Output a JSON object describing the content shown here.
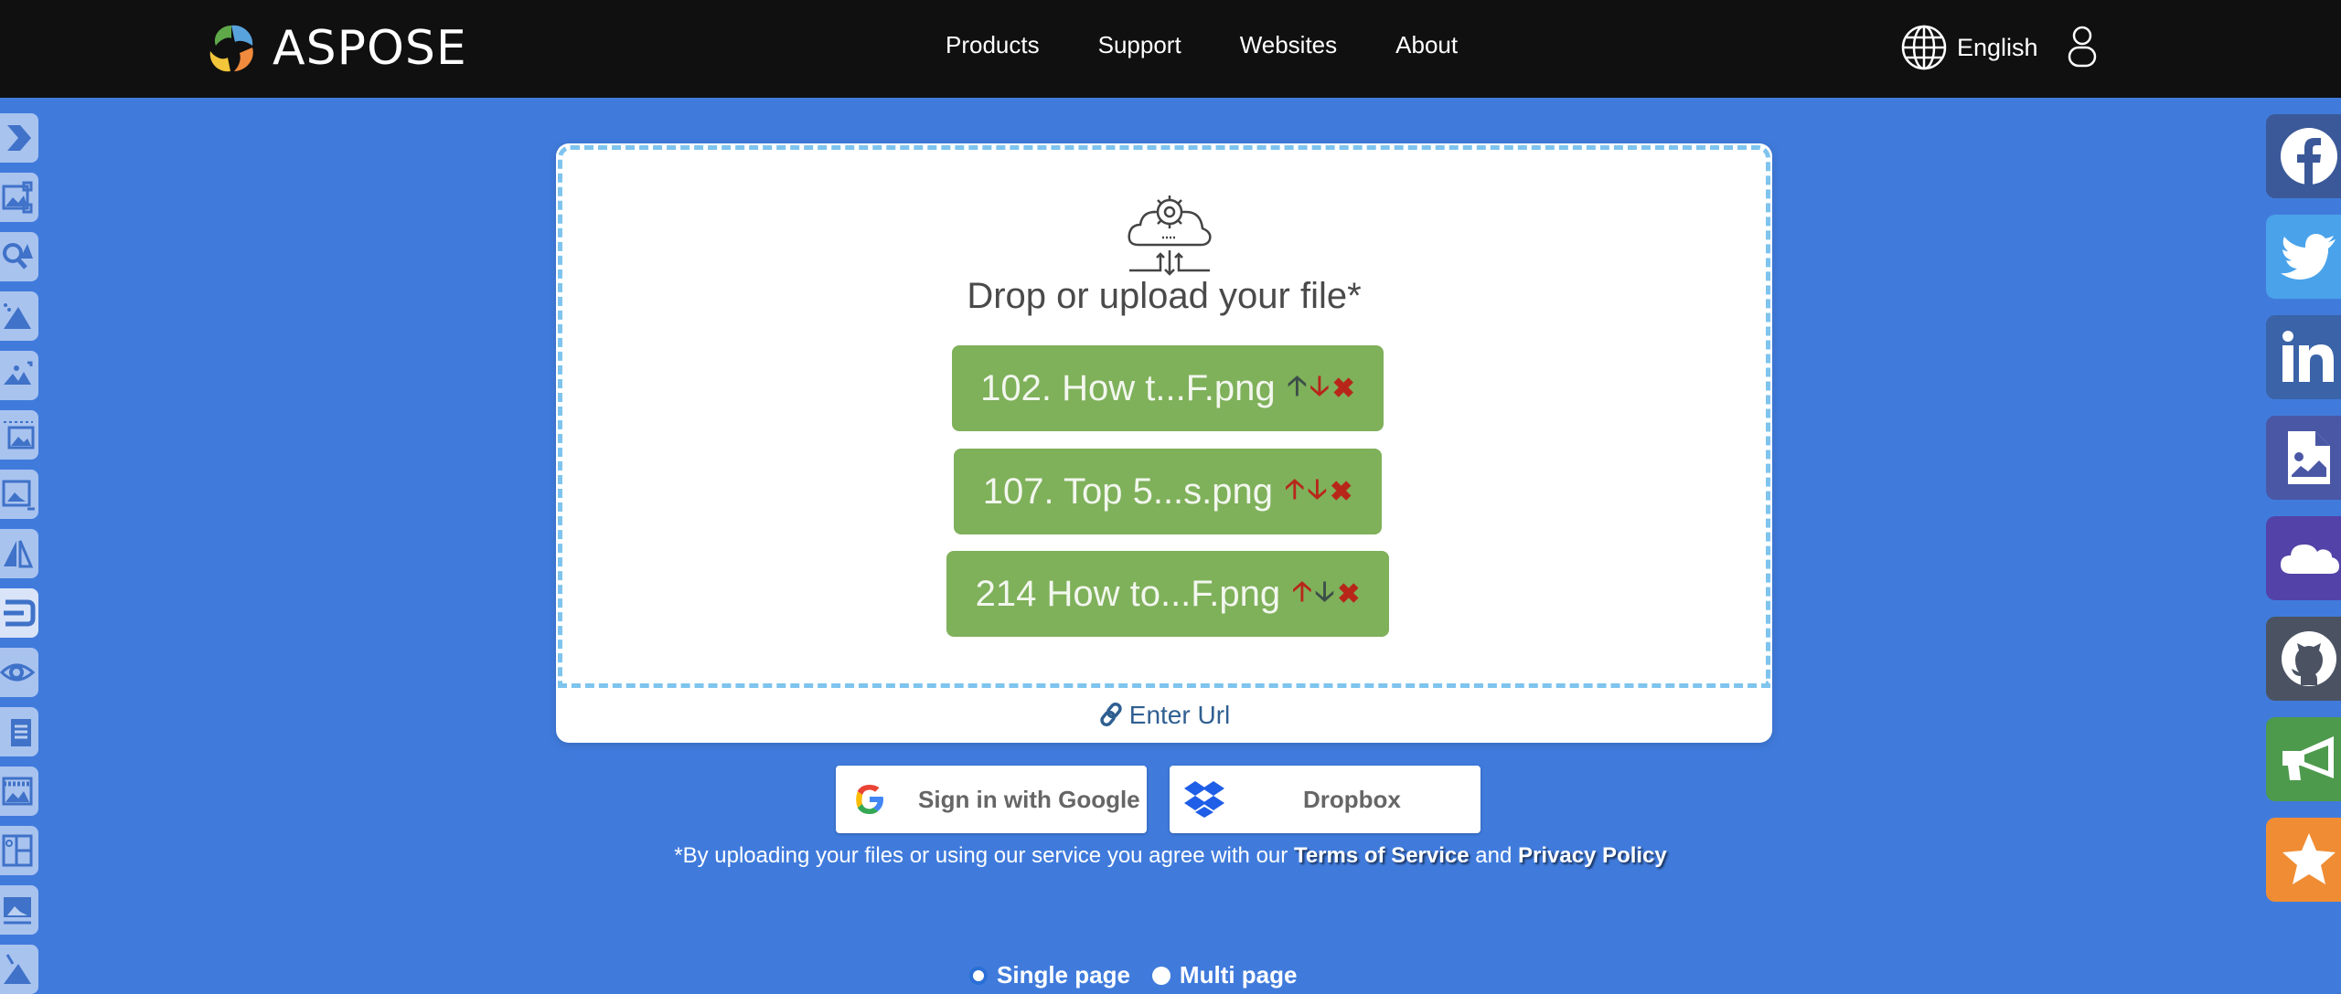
{
  "header": {
    "brand": "ASPOSE",
    "nav": [
      "Products",
      "Support",
      "Websites",
      "About"
    ],
    "language": "English"
  },
  "left_rail": {
    "items": [
      {
        "icon": "chevron-right-icon"
      },
      {
        "icon": "image-resize-icon"
      },
      {
        "icon": "image-search-icon"
      },
      {
        "icon": "image-compress-icon"
      },
      {
        "icon": "image-crop-icon"
      },
      {
        "icon": "image-border-icon"
      },
      {
        "icon": "image-frame-icon"
      },
      {
        "icon": "image-flip-icon"
      },
      {
        "icon": "merge-icon",
        "active": true
      },
      {
        "icon": "eye-icon"
      },
      {
        "icon": "document-convert-icon"
      },
      {
        "icon": "image-watermark-icon"
      },
      {
        "icon": "collage-icon"
      },
      {
        "icon": "image-caption-icon"
      },
      {
        "icon": "image-edit-icon"
      }
    ]
  },
  "social": [
    {
      "name": "facebook",
      "color": "#3b5998"
    },
    {
      "name": "twitter",
      "color": "#4aa3ea"
    },
    {
      "name": "linkedin",
      "color": "#3a63a8"
    },
    {
      "name": "file-image",
      "color": "#4a57a5"
    },
    {
      "name": "cloud",
      "color": "#5342a8"
    },
    {
      "name": "github",
      "color": "#4b5363"
    },
    {
      "name": "announcement",
      "color": "#4e9a4d"
    },
    {
      "name": "star",
      "color": "#f08d34"
    }
  ],
  "upload": {
    "title": "Drop or upload your file*",
    "files": [
      {
        "name": "102. How t...F.png",
        "up_color": "#3c4e48",
        "down_color": "#b8261a"
      },
      {
        "name": "107. Top 5...s.png",
        "up_color": "#b8261a",
        "down_color": "#b8261a"
      },
      {
        "name": "214 How to...F.png",
        "up_color": "#b8261a",
        "down_color": "#3c4e48"
      }
    ],
    "glyphs": {
      "up": "🡡",
      "down": "🡣",
      "remove": "✖"
    },
    "enter_url": "Enter Url"
  },
  "cloud_buttons": {
    "google": "Sign in with Google",
    "dropbox": "Dropbox"
  },
  "consent": {
    "text": "*By uploading your files or using our service you agree with our",
    "terms": "Terms of Service",
    "and": "and",
    "privacy": "Privacy Policy"
  },
  "mode": {
    "single": "Single page",
    "multi": "Multi page",
    "selected": "single"
  },
  "colors": {
    "background": "#407bdc",
    "header": "#101010",
    "chip": "#7fb05a",
    "dash": "#7ec4ee"
  }
}
